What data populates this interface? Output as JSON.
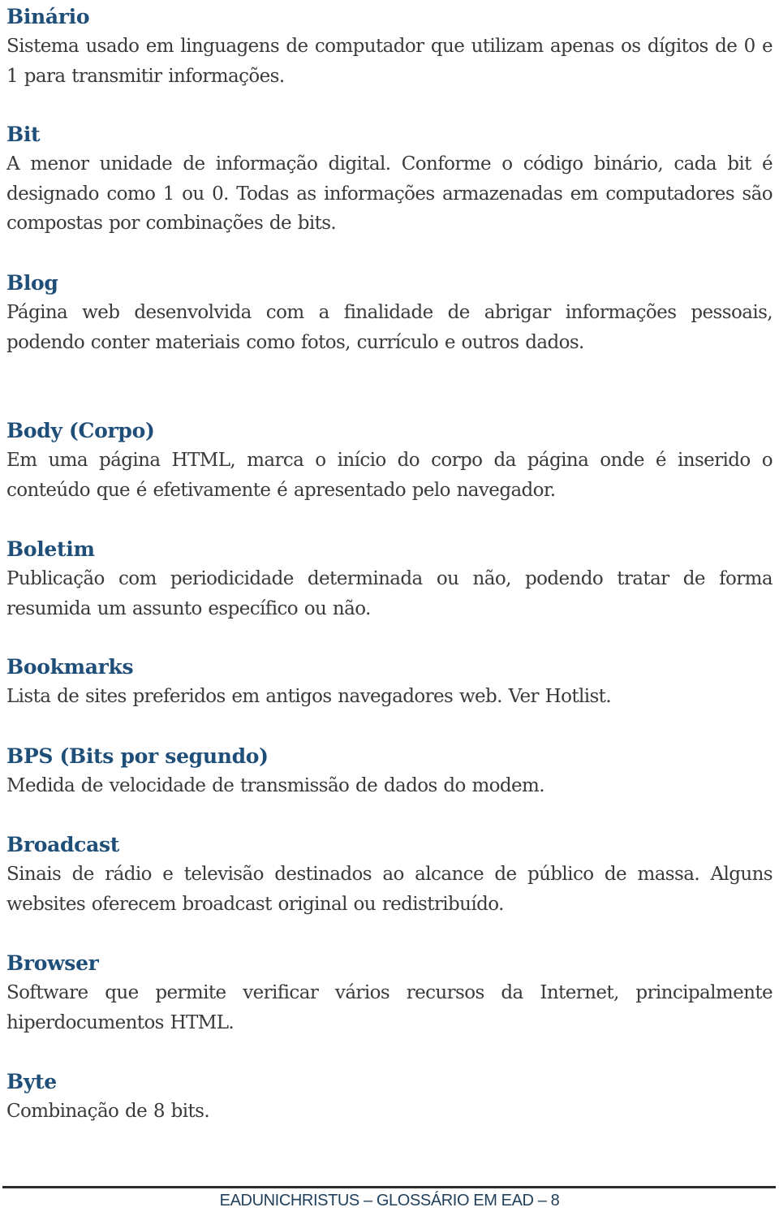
{
  "entries": [
    {
      "term": "Binário",
      "definition": "Sistema usado em linguagens de computador que utilizam apenas os dígitos de 0 e 1 para transmitir informações."
    },
    {
      "term": "Bit",
      "definition": "A menor unidade de informação digital. Conforme o código binário, cada bit é designado como 1 ou 0. Todas as informações armazenadas em computadores são compostas por combinações de bits."
    },
    {
      "term": "Blog",
      "definition": "Página web desenvolvida com a finalidade de abrigar informações pessoais, podendo conter materiais como fotos, currículo e outros dados."
    },
    {
      "term": "Body (Corpo)",
      "definition": "Em uma página HTML, marca o início do corpo da página onde é inserido o conteúdo que é efetivamente é apresentado pelo navegador."
    },
    {
      "term": "Boletim",
      "definition": "Publicação com periodicidade determinada ou não, podendo tratar de forma resumida um assunto específico ou não."
    },
    {
      "term": "Bookmarks",
      "definition": "Lista de sites preferidos em antigos navegadores web. Ver Hotlist."
    },
    {
      "term": "BPS (Bits por segundo)",
      "definition": "Medida de velocidade de transmissão de dados do modem."
    },
    {
      "term": "Broadcast",
      "definition": "Sinais de rádio e televisão destinados ao alcance de público de massa. Alguns websites oferecem broadcast original ou redistribuído."
    },
    {
      "term": "Browser",
      "definition": "Software que permite verificar vários recursos da Internet, principalmente hiperdocumentos HTML."
    },
    {
      "term": "Byte",
      "definition": "Combinação de 8 bits."
    }
  ],
  "footer": {
    "text": "EADUNICHRISTUS – GLOSSÁRIO EM EAD – 8"
  },
  "colors": {
    "term": "#1f4e79",
    "body_text": "#3a3a3a",
    "footer_text": "#1f3f5a"
  }
}
